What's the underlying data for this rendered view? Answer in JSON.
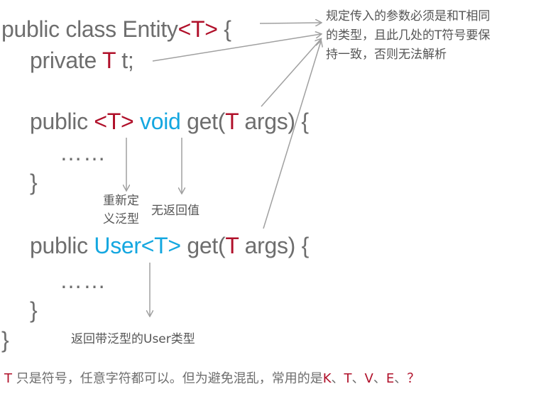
{
  "colors": {
    "code_gray": "#6e6e6e",
    "type_red": "#b0102a",
    "type_blue": "#14a7e0",
    "arrow": "#a0a0a0"
  },
  "code": {
    "line1": {
      "prefix": "public class Entity",
      "generic": "<T>",
      "suffix": " {"
    },
    "line2": {
      "prefix": "private ",
      "type": "T",
      "suffix": " t;"
    },
    "line3": {
      "prefix": "public ",
      "generic": "<T>",
      "ret": "void",
      "mid": " get(",
      "param_type": "T",
      "suffix": " args) {"
    },
    "line4": {
      "dots": "……"
    },
    "line5": {
      "brace": "}"
    },
    "line6": {
      "prefix": "public ",
      "ret": "User<T>",
      "mid": " get(",
      "param_type": "T",
      "suffix": " args) {"
    },
    "line7": {
      "dots": "……"
    },
    "line8": {
      "brace": "}"
    },
    "line9": {
      "brace": "}"
    }
  },
  "notes": {
    "top_right": [
      "规定传入的参数必须是和T相同",
      "的类型，且此几处的T符号要保",
      "持一致，否则无法解析"
    ],
    "redefine": [
      "重新定",
      "义泛型"
    ],
    "no_return": "无返回值",
    "return_user": "返回带泛型的User类型"
  },
  "footer": {
    "part1": "T",
    "part2": " 只是符号，任意字符都可以。但为避免混乱，常用的是",
    "k": "K",
    "sep1": "、",
    "t": "T",
    "sep2": "、",
    "v": "V",
    "sep3": "、",
    "e": "E",
    "sep4": "、",
    "q": "？"
  }
}
